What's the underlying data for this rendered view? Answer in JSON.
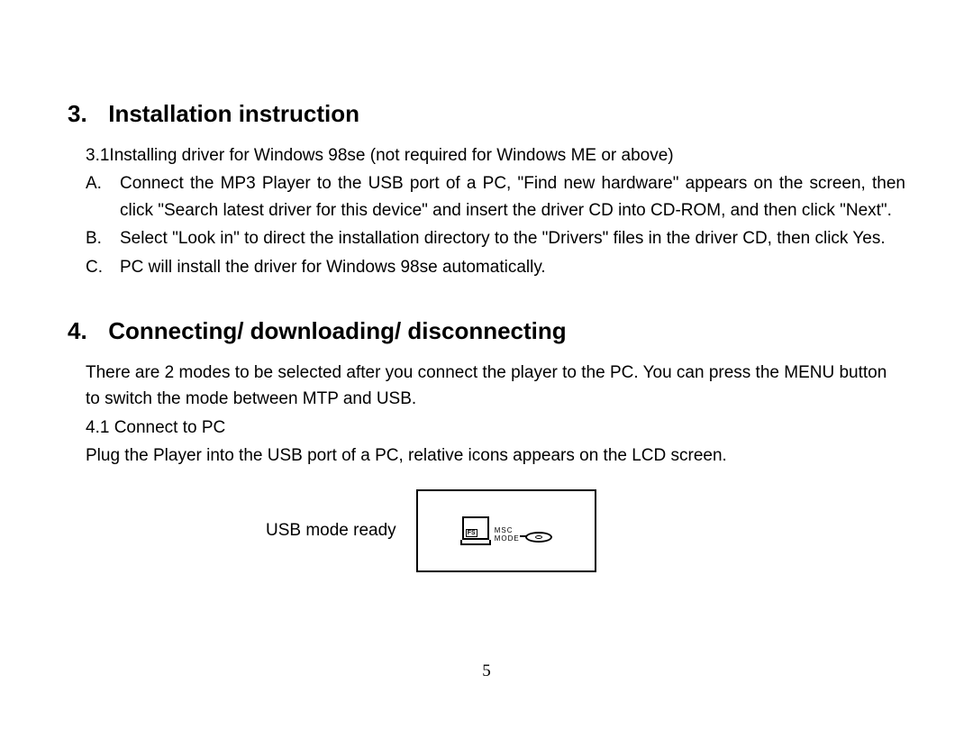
{
  "section3": {
    "number": "3.",
    "title": "Installation instruction",
    "sub": "3.1Installing driver for Windows 98se (not required for Windows ME or above)",
    "items": [
      {
        "label": "A.",
        "text": "Connect the MP3 Player to the USB port of a PC, \"Find new hardware\" appears on the screen, then click \"Search latest driver for this device\" and insert the driver CD into CD-ROM, and then click \"Next\"."
      },
      {
        "label": "B.",
        "text": "Select \"Look in\" to direct the installation directory to the \"Drivers\" files in the driver CD, then click Yes."
      },
      {
        "label": "C.",
        "text": "PC will install the driver for Windows 98se automatically."
      }
    ]
  },
  "section4": {
    "number": "4.",
    "title": "Connecting/ downloading/ disconnecting",
    "intro": "There are 2 modes to be selected after you connect the player to the PC. You can press the MENU button to switch the mode between MTP and USB.",
    "sub41": "4.1 Connect to PC",
    "sub41_text": "Plug the Player into the USB port of a PC, relative icons appears on the LCD screen.",
    "usb_label": "USB mode ready",
    "lcd": {
      "fs": "FS",
      "msc": "MSC",
      "mode": "MODE"
    }
  },
  "page_number": "5"
}
